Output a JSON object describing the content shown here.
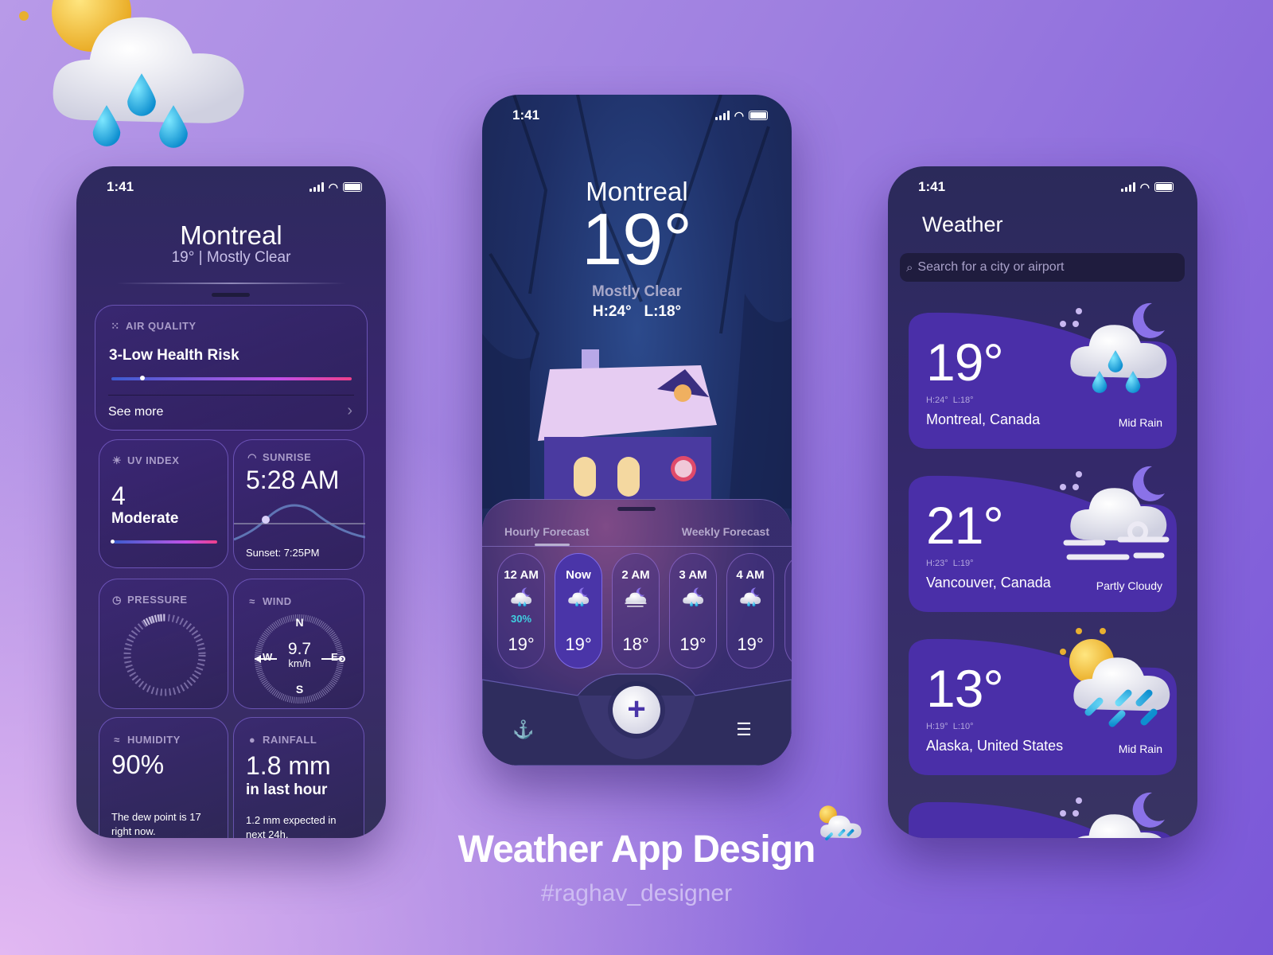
{
  "colors": {
    "accent": "#4a35a8",
    "rain_chance": "#3fd0e0",
    "background": "#9e7fe0"
  },
  "status_time": "1:41",
  "left": {
    "city": "Montreal",
    "subtitle": "19° | Mostly Clear",
    "air_quality": {
      "label": "AIR QUALITY",
      "value": "3-Low Health Risk",
      "level_fraction": 0.13,
      "see_more": "See more"
    },
    "uv": {
      "label": "UV INDEX",
      "value": "4",
      "desc": "Moderate",
      "level_fraction": 0.0
    },
    "sunrise": {
      "label": "SUNRISE",
      "value": "5:28 AM",
      "sunset": "Sunset: 7:25PM"
    },
    "pressure": {
      "label": "PRESSURE"
    },
    "wind": {
      "label": "WIND",
      "speed": "9.7",
      "unit": "km/h",
      "n": "N",
      "s": "S",
      "e": "E",
      "w": "W"
    },
    "humidity": {
      "label": "HUMIDITY",
      "value": "90%",
      "note": "The dew point is 17 right now."
    },
    "rainfall": {
      "label": "RAINFALL",
      "value": "1.8 mm",
      "sub": "in last hour",
      "note": "1.2 mm expected in next 24h."
    }
  },
  "center": {
    "city": "Montreal",
    "temp": "19°",
    "condition": "Mostly Clear",
    "hilo": "H:24°   L:18°",
    "tabs": [
      "Hourly Forecast",
      "Weekly Forecast"
    ],
    "active_tab": 0,
    "hourly": [
      {
        "time": "12 AM",
        "chance": "30%",
        "temp": "19°",
        "icon": "moon-cloud-rain-icon"
      },
      {
        "time": "Now",
        "temp": "19°",
        "icon": "moon-cloud-rain-icon"
      },
      {
        "time": "2 AM",
        "temp": "18°",
        "icon": "moon-cloud-wind-icon"
      },
      {
        "time": "3 AM",
        "temp": "19°",
        "icon": "moon-cloud-rain-icon"
      },
      {
        "time": "4 AM",
        "temp": "19°",
        "icon": "moon-cloud-rain-icon"
      }
    ]
  },
  "right": {
    "title": "Weather",
    "search_placeholder": "Search for a city or airport",
    "cities": [
      {
        "temp": "19°",
        "hilo": "H:24°  L:18°",
        "name": "Montreal, Canada",
        "condition": "Mid Rain",
        "icon": "moon-cloud-rain-icon"
      },
      {
        "temp": "21°",
        "hilo": "H:23°  L:19°",
        "name": "Vancouver, Canada",
        "condition": "Partly Cloudy",
        "icon": "moon-cloud-wind-icon"
      },
      {
        "temp": "13°",
        "hilo": "H:19°  L:10°",
        "name": "Alaska, United States",
        "condition": "Mid Rain",
        "icon": "sun-cloud-rain-icon"
      }
    ]
  },
  "footer": {
    "title": "Weather App Design",
    "handle": "#raghav_designer"
  }
}
